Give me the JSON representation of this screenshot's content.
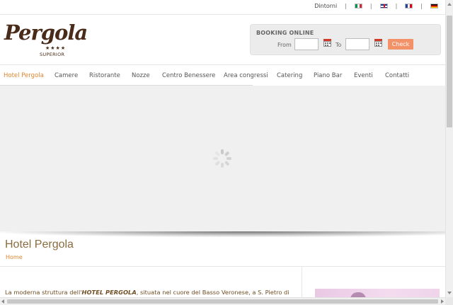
{
  "topbar": {
    "dintorni": "Dintorni",
    "separator": "|",
    "languages": [
      {
        "code": "it",
        "icon": "italy-flag-icon"
      },
      {
        "code": "en",
        "icon": "uk-flag-icon"
      },
      {
        "code": "fr",
        "icon": "france-flag-icon"
      },
      {
        "code": "de",
        "icon": "germany-flag-icon"
      }
    ]
  },
  "logo": {
    "name": "Pergola",
    "stars": "★★★★",
    "tag": "SUPERIOR"
  },
  "booking": {
    "title": "BOOKING ONLINE",
    "from_label": "From",
    "to_label": "To",
    "from_value": "",
    "to_value": "",
    "check_label": "Check",
    "accent": "#f39268"
  },
  "nav": {
    "active_color": "#e0852f",
    "items": [
      {
        "label": "Hotel Pergola",
        "active": true
      },
      {
        "label": "Camere"
      },
      {
        "label": "Ristorante"
      },
      {
        "label": "Nozze"
      },
      {
        "label": "Centro Benessere"
      },
      {
        "label": "Area congressi"
      },
      {
        "label": "Catering"
      },
      {
        "label": "Piano Bar"
      },
      {
        "label": "Eventi"
      },
      {
        "label": "Contatti"
      }
    ]
  },
  "page": {
    "title": "Hotel Pergola",
    "breadcrumb": "Home",
    "intro_prefix": "La moderna struttura dell'",
    "intro_bold": "HOTEL PERGOLA",
    "intro_suffix": ", situata nel cuore del Basso Veronese, a S. Pietro di"
  }
}
